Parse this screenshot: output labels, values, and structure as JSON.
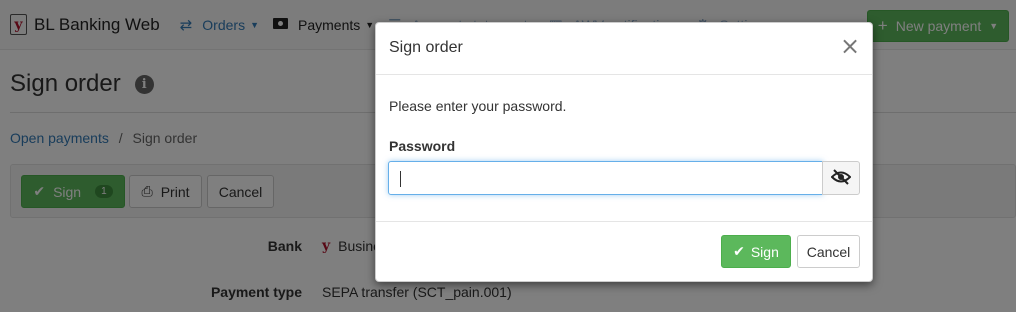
{
  "navbar": {
    "brand_logo": "y",
    "brand": "BL Banking Web",
    "orders": "Orders",
    "payments": "Payments",
    "faded_item_1": "Account statements",
    "faded_item_2": "AWV notifications",
    "faded_item_3": "Settings",
    "new_payment": "New payment"
  },
  "page": {
    "title": "Sign order",
    "info_icon": "i",
    "breadcrumb": {
      "parent": "Open payments",
      "separator": "/",
      "current": "Sign order"
    },
    "toolbar": {
      "sign": "Sign",
      "sign_count": "1",
      "print": "Print",
      "cancel": "Cancel"
    },
    "fields": [
      {
        "label": "Bank",
        "value": "Business"
      },
      {
        "label": "Payment type",
        "value": "SEPA transfer (SCT_pain.001)"
      }
    ]
  },
  "modal": {
    "title": "Sign order",
    "close_glyph": "×",
    "prompt": "Please enter your password.",
    "password_label": "Password",
    "password_value": "",
    "sign": "Sign",
    "cancel": "Cancel"
  },
  "icons": {
    "orders": "exchange-arrows-icon",
    "payments": "money-icon",
    "toggle": "eye-slash-icon"
  },
  "colors": {
    "primary_link": "#337ab7",
    "success": "#5cb85c",
    "focus": "#66afe9"
  }
}
